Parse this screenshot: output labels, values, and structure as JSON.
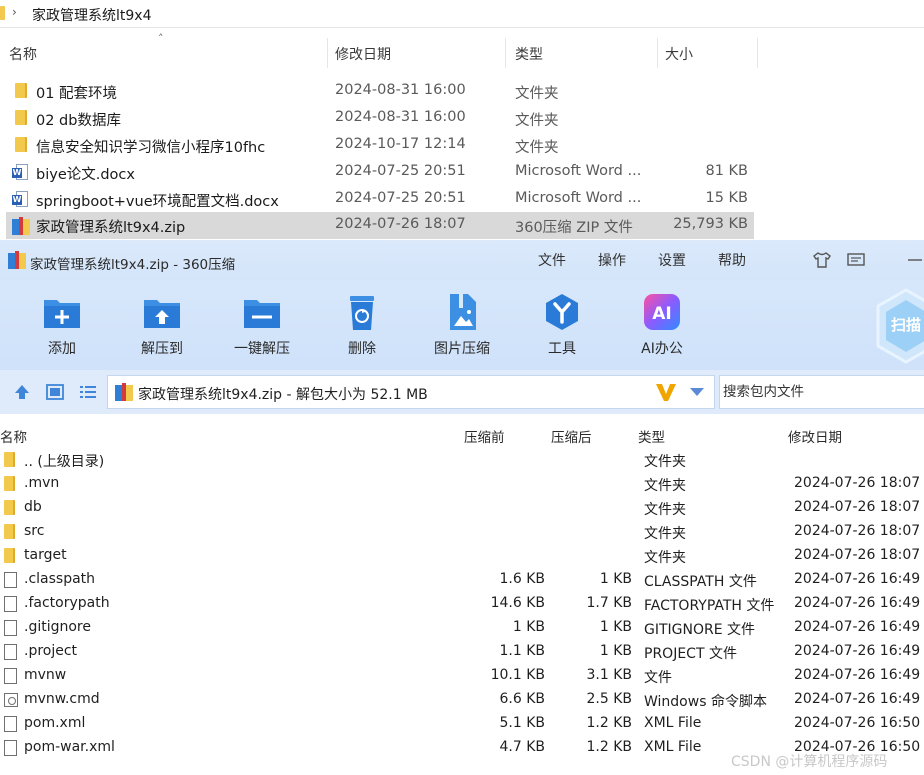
{
  "explorer": {
    "breadcrumb": "家政管理系统lt9x4",
    "columns": {
      "name": "名称",
      "modified": "修改日期",
      "type": "类型",
      "size": "大小"
    },
    "rows": [
      {
        "name": "01 配套环境",
        "date": "2024-08-31 16:00",
        "type": "文件夹",
        "size": "",
        "icon": "folder-icon"
      },
      {
        "name": "02 db数据库",
        "date": "2024-08-31 16:00",
        "type": "文件夹",
        "size": "",
        "icon": "folder-icon"
      },
      {
        "name": "信息安全知识学习微信小程序10fhc",
        "date": "2024-10-17 12:14",
        "type": "文件夹",
        "size": "",
        "icon": "folder-icon"
      },
      {
        "name": "biye论文.docx",
        "date": "2024-07-25 20:51",
        "type": "Microsoft Word ...",
        "size": "81 KB",
        "icon": "word-doc-icon"
      },
      {
        "name": "springboot+vue环境配置文档.docx",
        "date": "2024-07-25 20:51",
        "type": "Microsoft Word ...",
        "size": "15 KB",
        "icon": "word-doc-icon"
      },
      {
        "name": "家政管理系统lt9x4.zip",
        "date": "2024-07-26 18:07",
        "type": "360压缩 ZIP 文件",
        "size": "25,793 KB",
        "icon": "zip-archive-icon",
        "selected": true
      }
    ]
  },
  "zip": {
    "title": "家政管理系统lt9x4.zip - 360压缩",
    "menu": [
      "文件",
      "操作",
      "设置",
      "帮助"
    ],
    "toolbar": [
      "添加",
      "解压到",
      "一键解压",
      "删除",
      "图片压缩",
      "工具",
      "AI办公"
    ],
    "scan_label": "扫描",
    "address": "家政管理系统lt9x4.zip - 解包大小为 52.1 MB",
    "search_placeholder": "搜索包内文件",
    "columns": {
      "name": "名称",
      "compressed_before": "压缩前",
      "compressed_after": "压缩后",
      "type": "类型",
      "modified": "修改日期"
    },
    "rows": [
      {
        "name": ".. (上级目录)",
        "before": "",
        "after": "",
        "type": "文件夹",
        "date": "",
        "icon": "folder"
      },
      {
        "name": ".mvn",
        "before": "",
        "after": "",
        "type": "文件夹",
        "date": "2024-07-26 18:07",
        "icon": "folder"
      },
      {
        "name": "db",
        "before": "",
        "after": "",
        "type": "文件夹",
        "date": "2024-07-26 18:07",
        "icon": "folder"
      },
      {
        "name": "src",
        "before": "",
        "after": "",
        "type": "文件夹",
        "date": "2024-07-26 18:07",
        "icon": "folder"
      },
      {
        "name": "target",
        "before": "",
        "after": "",
        "type": "文件夹",
        "date": "2024-07-26 18:07",
        "icon": "folder"
      },
      {
        "name": ".classpath",
        "before": "1.6 KB",
        "after": "1 KB",
        "type": "CLASSPATH 文件",
        "date": "2024-07-26 16:49",
        "icon": "file"
      },
      {
        "name": ".factorypath",
        "before": "14.6 KB",
        "after": "1.7 KB",
        "type": "FACTORYPATH 文件",
        "date": "2024-07-26 16:49",
        "icon": "file"
      },
      {
        "name": ".gitignore",
        "before": "1 KB",
        "after": "1 KB",
        "type": "GITIGNORE 文件",
        "date": "2024-07-26 16:49",
        "icon": "file"
      },
      {
        "name": ".project",
        "before": "1.1 KB",
        "after": "1 KB",
        "type": "PROJECT 文件",
        "date": "2024-07-26 16:49",
        "icon": "file"
      },
      {
        "name": "mvnw",
        "before": "10.1 KB",
        "after": "3.1 KB",
        "type": "文件",
        "date": "2024-07-26 16:49",
        "icon": "file"
      },
      {
        "name": "mvnw.cmd",
        "before": "6.6 KB",
        "after": "2.5 KB",
        "type": "Windows 命令脚本",
        "date": "2024-07-26 16:49",
        "icon": "cmd"
      },
      {
        "name": "pom.xml",
        "before": "5.1 KB",
        "after": "1.2 KB",
        "type": "XML File",
        "date": "2024-07-26 16:50",
        "icon": "file"
      },
      {
        "name": "pom-war.xml",
        "before": "4.7 KB",
        "after": "1.2 KB",
        "type": "XML File",
        "date": "2024-07-26 16:50",
        "icon": "file"
      }
    ]
  },
  "watermark": "CSDN @计算机程序源码"
}
